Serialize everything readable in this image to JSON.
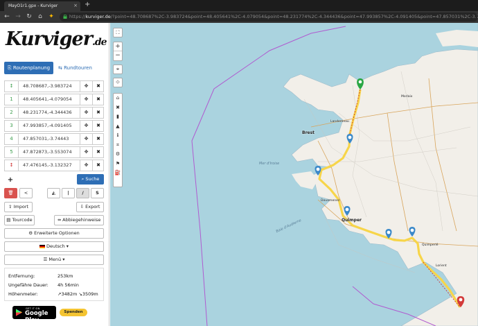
{
  "browser": {
    "tab_title": "MayO1r1.gpx - Kurviger",
    "tab_close": "×",
    "new_tab": "+",
    "url_scheme": "https://",
    "url_host": "kurviger.de",
    "url_rest": "/?point=48.708687%2C-3.983724&point=48.405641%2C-4.079054&point=48.231774%2C-4.344436&point=47.993857%2C-4.091405&point=47.857031%2C-3.74443&point=47.872873%2C-3.553074"
  },
  "sidebar": {
    "logo": "Kurviger",
    "logo_tld": ".de",
    "tabs": {
      "route": "Routenplanung",
      "round": "Rundtouren"
    },
    "waypoints": [
      {
        "marker": "↕",
        "value": "48.708687,-3.983724",
        "is_end": false
      },
      {
        "marker": "1",
        "value": "48.405641,-4.079054",
        "is_end": false
      },
      {
        "marker": "2",
        "value": "48.231774,-4.344436",
        "is_end": false
      },
      {
        "marker": "3",
        "value": "47.993857,-4.091405",
        "is_end": false
      },
      {
        "marker": "4",
        "value": "47.857031,-3.74443",
        "is_end": false
      },
      {
        "marker": "5",
        "value": "47.872873,-3.553074",
        "is_end": false
      },
      {
        "marker": "↕",
        "value": "47.476145,-3.132327",
        "is_end": true
      }
    ],
    "move_icon": "✥",
    "delete_icon": "✖",
    "add_label": "+",
    "search_label": "Suche",
    "trash_icon": "🗑",
    "share_icon": "<",
    "mode_labels": [
      "◭",
      "|",
      "/",
      "S"
    ],
    "import_label": "Import",
    "export_label": "Export",
    "tourcode_label": "Tourcode",
    "turn_label": "Abbiegehinweise",
    "advanced_label": "Erweiterte Optionen",
    "language_label": "Deutsch ▾",
    "menu_label": "Menü ▾",
    "stats": [
      {
        "label": "Entfernung:",
        "value": "253km"
      },
      {
        "label": "Ungefähre Dauer:",
        "value": "4h 56min"
      },
      {
        "label": "Höhenmeter:",
        "value": "↗3482m ↘3509m"
      }
    ],
    "gplay_small": "GET IT ON",
    "gplay_big": "Google Play",
    "donate_label": "Spenden"
  },
  "map": {
    "controls": {
      "fullscreen": "⛶",
      "zoom_in": "+",
      "zoom_out": "−",
      "locate": "⌖",
      "move": "✥"
    },
    "tools": [
      "⌂",
      "✖",
      "▮",
      "▲",
      "ℹ",
      "⌗",
      "⚙",
      "⚑",
      "⛽"
    ],
    "places": [
      {
        "name": "Brest",
        "cls": ""
      },
      {
        "name": "Morlaix",
        "cls": "small"
      },
      {
        "name": "Landerneau",
        "cls": "small"
      },
      {
        "name": "Quimper",
        "cls": ""
      },
      {
        "name": "Douarnenez",
        "cls": "small"
      },
      {
        "name": "Quimperlé",
        "cls": "small"
      },
      {
        "name": "Lorient",
        "cls": "small"
      },
      {
        "name": "Baie d'Audierne",
        "cls": "sea"
      },
      {
        "name": "Mer d'Iroise",
        "cls": "sea"
      }
    ]
  },
  "colors": {
    "sea": "#aad3df",
    "land": "#f2efe9",
    "route": "#f7d54a",
    "accent": "#2e6eb5",
    "start_marker": "#2aa744",
    "end_marker": "#d33a3a",
    "border": "#b05bd0"
  }
}
